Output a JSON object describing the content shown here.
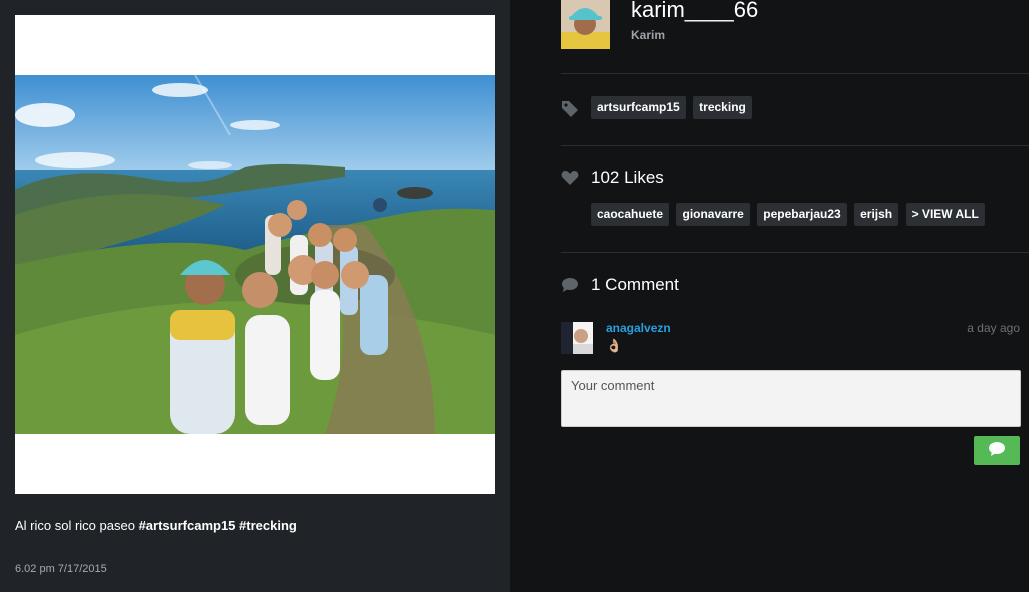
{
  "post": {
    "caption_text": "Al rico sol rico paseo",
    "caption_hashtags": [
      "#artsurfcamp15",
      "#trecking"
    ],
    "timestamp": "6.02 pm 7/17/2015"
  },
  "user": {
    "username": "karim____66",
    "full_name": "Karim"
  },
  "tags": [
    "artsurfcamp15",
    "trecking"
  ],
  "likes": {
    "label": "102 Likes",
    "likers": [
      "caocahuete",
      "gionavarre",
      "pepebarjau23",
      "erijsh"
    ],
    "view_all_label": "> VIEW ALL"
  },
  "comments": {
    "label": "1 Comment",
    "items": [
      {
        "author": "anagalvezn",
        "time": "a day ago",
        "text": "👌🏼"
      }
    ],
    "input_placeholder": "Your comment"
  },
  "colors": {
    "left_panel_bg": "#202428",
    "right_panel_bg": "#111315",
    "pill_bg": "#2c3035",
    "link_blue": "#2a9fe0",
    "send_green": "#55b955"
  },
  "icons": {
    "tag": "tag-icon",
    "like": "heart-icon",
    "comment": "speech-bubble-icon",
    "send": "chat-bubble-icon"
  }
}
